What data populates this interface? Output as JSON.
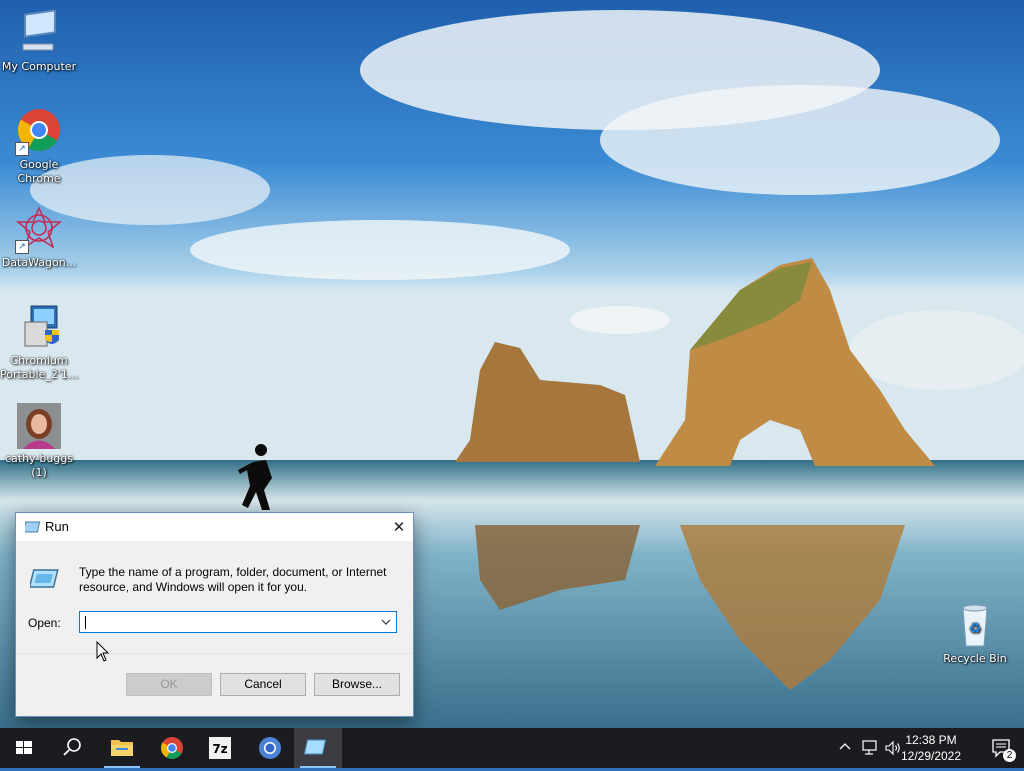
{
  "desktop": {
    "icons": [
      {
        "label": "My Computer",
        "icon": "computer-icon"
      },
      {
        "label": "Google Chrome",
        "icon": "chrome-icon"
      },
      {
        "label": "DataWagon...",
        "icon": "datawagon-icon"
      },
      {
        "label": "Chromium Portable_2'1...",
        "icon": "chromium-portable-installer-icon"
      },
      {
        "label": "cathy-buggs (1)",
        "icon": "photo-thumbnail-icon"
      },
      {
        "label": "Recycle Bin",
        "icon": "recycle-bin-icon"
      }
    ]
  },
  "run_dialog": {
    "title": "Run",
    "close_glyph": "✕",
    "message": "Type the name of a program, folder, document, or Internet resource, and Windows will open it for you.",
    "open_label": "Open:",
    "open_value": "",
    "buttons": {
      "ok": "OK",
      "cancel": "Cancel",
      "browse": "Browse..."
    }
  },
  "taskbar": {
    "pinned": [
      {
        "name": "start-button",
        "icon": "windows-logo-icon"
      },
      {
        "name": "search-button",
        "icon": "search-icon"
      },
      {
        "name": "file-explorer-button",
        "icon": "folder-icon"
      },
      {
        "name": "chrome-taskbar-button",
        "icon": "chrome-icon"
      },
      {
        "name": "7zip-taskbar-button",
        "icon": "7zip-icon",
        "label": "7z"
      },
      {
        "name": "chromium-taskbar-button",
        "icon": "chromium-icon"
      },
      {
        "name": "run-taskbar-button",
        "icon": "run-icon",
        "active": true
      }
    ],
    "tray": {
      "time": "12:38 PM",
      "date": "12/29/2022",
      "notifications_count": "2"
    }
  },
  "colors": {
    "taskbar": "#1b1c1f",
    "accent": "#0078d7",
    "dialog_bg": "#f0f0f0"
  }
}
